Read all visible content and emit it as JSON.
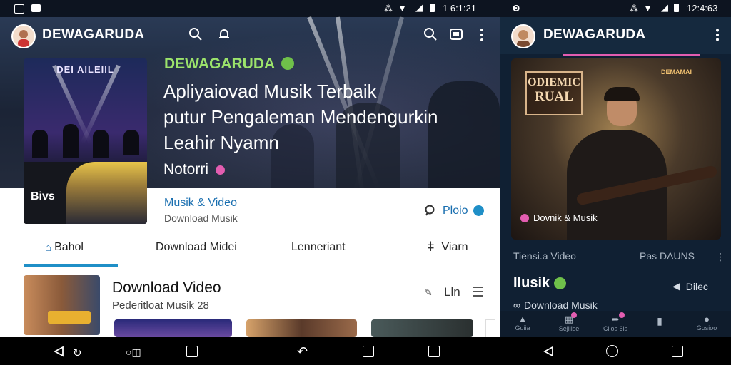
{
  "left": {
    "status": {
      "time": "1 6:1:21"
    },
    "appbar": {
      "title": "DEWAGARUDA",
      "icons": [
        "search-icon",
        "bell-icon",
        "search-icon",
        "cast-icon",
        "more-vert-icon"
      ]
    },
    "card": {
      "title": "DEI AlLEIIL",
      "badge": "Bivs"
    },
    "hero": {
      "brand": "DEWAGARUDA",
      "headline": [
        "Apliyaiovad Musik Terbaik",
        "putur Pengaleman Mendengurkin",
        "Leahir Nyamn"
      ],
      "sub": "Notorri"
    },
    "info": {
      "category": "Musik & Video",
      "desc": "Download Musik",
      "action": "Ploio"
    },
    "tabs": [
      "Bahol",
      "Download Midei",
      "Lenneriant",
      "Viarn"
    ],
    "list": {
      "title": "Download Video",
      "subtitle": "Pederitloat Musik 28",
      "count": "Lln"
    }
  },
  "right": {
    "status": {
      "time": "12:4:63"
    },
    "appbar": {
      "title": "DEWAGARUDA"
    },
    "art": {
      "title_line1": "ODIEMIC",
      "title_line2": "RUAL",
      "top_text": "DEMAMAI",
      "label": "Dovnik & Musik"
    },
    "meta": {
      "left": "Tiensi.a Video",
      "right": "Pas DAUNS"
    },
    "section": {
      "title": "Ilusik",
      "action": "Dilec",
      "sub": "Download Musik"
    },
    "nav": [
      "Guiia",
      "Sejilise",
      "Clios 6ls",
      "",
      "Gosioo"
    ]
  },
  "colors": {
    "accent_green": "#9be36b",
    "accent_pink": "#e35db0",
    "link_blue": "#1a6fb0",
    "tab_indicator": "#1f8fc7"
  }
}
